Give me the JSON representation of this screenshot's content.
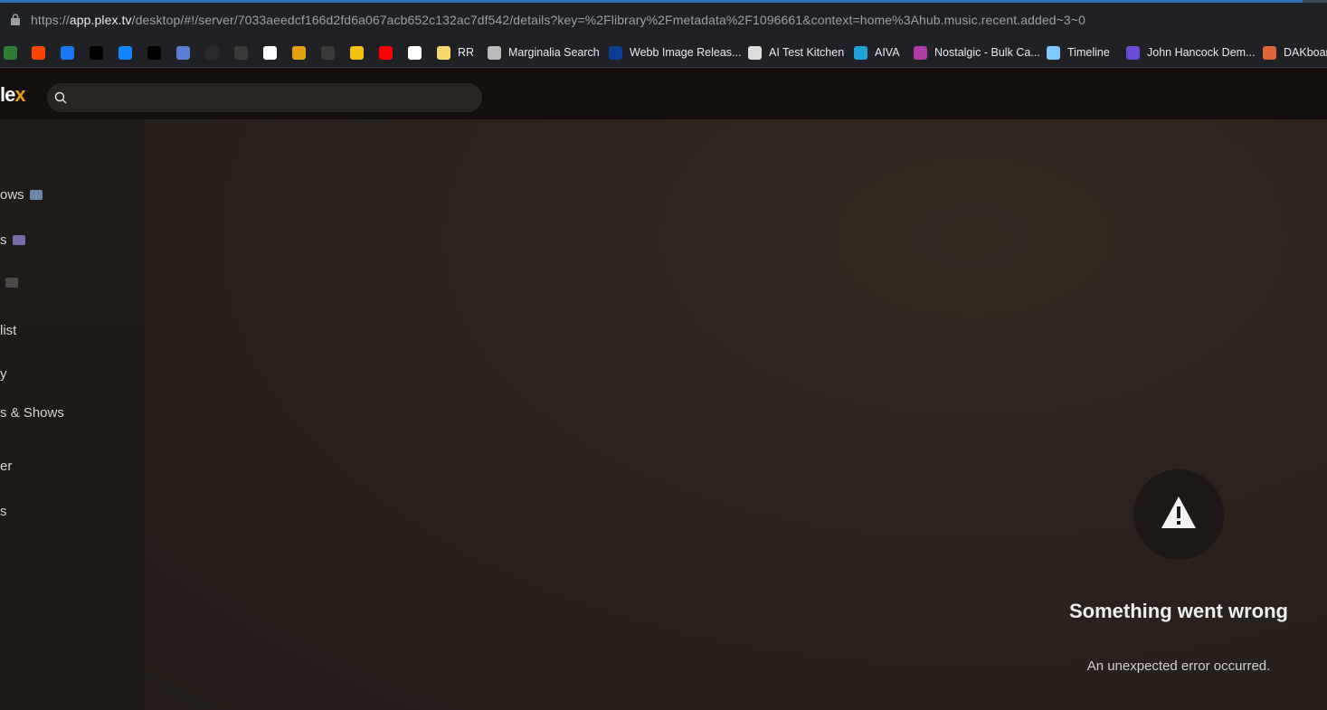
{
  "browser": {
    "url_prefix": "https://",
    "url_domain": "app.plex.tv",
    "url_path": "/desktop/#!/server/7033aeedcf166d2fd6a067acb652c132ac7df542/details?key=%2Flibrary%2Fmetadata%2F1096661&context=home%3Ahub.music.recent.added~3~0"
  },
  "bookmarks": [
    {
      "name": "bm-1",
      "label": "",
      "color": "#2e7d32"
    },
    {
      "name": "bm-reddit",
      "label": "",
      "color": "#ff4500"
    },
    {
      "name": "bm-facebook",
      "label": "",
      "color": "#1877f2"
    },
    {
      "name": "bm-threads",
      "label": "",
      "color": "#000000"
    },
    {
      "name": "bm-bluesky",
      "label": "",
      "color": "#1185fe"
    },
    {
      "name": "bm-x",
      "label": "",
      "color": "#000000"
    },
    {
      "name": "bm-p",
      "label": "",
      "color": "#5b7fd6"
    },
    {
      "name": "bm-plex",
      "label": "",
      "color": "#282a2d"
    },
    {
      "name": "bm-9",
      "label": "",
      "color": "#3a3a3a"
    },
    {
      "name": "bm-10",
      "label": "",
      "color": "#ffffff"
    },
    {
      "name": "bm-11",
      "label": "",
      "color": "#e5a00d"
    },
    {
      "name": "bm-12",
      "label": "",
      "color": "#3a3a3a"
    },
    {
      "name": "bm-13",
      "label": "",
      "color": "#f4c20d"
    },
    {
      "name": "bm-youtube",
      "label": "",
      "color": "#ff0000"
    },
    {
      "name": "bm-amazon",
      "label": "",
      "color": "#ffffff"
    },
    {
      "name": "bm-rr",
      "label": "RR",
      "color": "#f6d86b"
    },
    {
      "name": "bm-marginalia",
      "label": "Marginalia Search",
      "color": "#bbbbbb"
    },
    {
      "name": "bm-webb",
      "label": "Webb Image Releas...",
      "color": "#0b3d91"
    },
    {
      "name": "bm-aitest",
      "label": "AI Test Kitchen",
      "color": "#dddddd"
    },
    {
      "name": "bm-aiva",
      "label": "AIVA",
      "color": "#1fa2d6"
    },
    {
      "name": "bm-nostalgic",
      "label": "Nostalgic - Bulk Ca...",
      "color": "#b03aa7"
    },
    {
      "name": "bm-timeline",
      "label": "Timeline",
      "color": "#7fc7ff"
    },
    {
      "name": "bm-johnhancock",
      "label": "John Hancock Dem...",
      "color": "#6a4bd8"
    },
    {
      "name": "bm-dakboard",
      "label": "DAKboard",
      "color": "#e0663a"
    }
  ],
  "header": {
    "logo_text": "le",
    "logo_x": "x"
  },
  "sidebar": {
    "items": [
      {
        "label": "ows",
        "emoji_color": "#6b86a8"
      },
      {
        "label": "s",
        "emoji_color": "#7a6aa8"
      },
      {
        "label": "",
        "emoji_color": "#4a4a4a"
      },
      {
        "label": "list",
        "emoji_color": ""
      },
      {
        "label": "y",
        "emoji_color": ""
      },
      {
        "label": "s & Shows",
        "emoji_color": ""
      },
      {
        "label": "er",
        "emoji_color": ""
      },
      {
        "label": "s",
        "emoji_color": ""
      }
    ]
  },
  "error": {
    "title": "Something went wrong",
    "message": "An unexpected error occurred."
  }
}
